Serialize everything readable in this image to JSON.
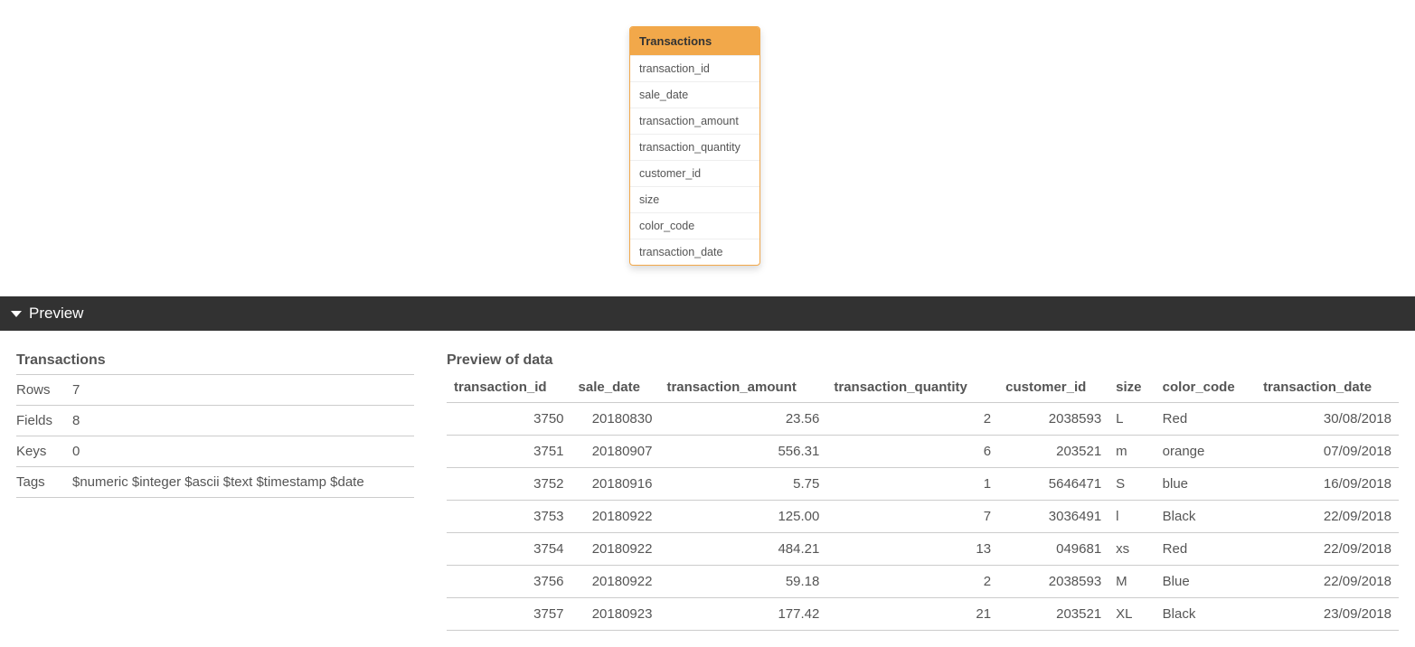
{
  "schema_card": {
    "title": "Transactions",
    "fields": [
      "transaction_id",
      "sale_date",
      "transaction_amount",
      "transaction_quantity",
      "customer_id",
      "size",
      "color_code",
      "transaction_date"
    ]
  },
  "preview_bar": {
    "label": "Preview"
  },
  "meta": {
    "title": "Transactions",
    "rows": {
      "label": "Rows",
      "value": "7"
    },
    "fields": {
      "label": "Fields",
      "value": "8"
    },
    "keys": {
      "label": "Keys",
      "value": "0"
    },
    "tags": {
      "label": "Tags",
      "value": "$numeric $integer $ascii $text $timestamp $date"
    }
  },
  "data_preview": {
    "title": "Preview of data",
    "columns": [
      {
        "name": "transaction_id",
        "align": "num"
      },
      {
        "name": "sale_date",
        "align": "num"
      },
      {
        "name": "transaction_amount",
        "align": "num"
      },
      {
        "name": "transaction_quantity",
        "align": "num"
      },
      {
        "name": "customer_id",
        "align": "num"
      },
      {
        "name": "size",
        "align": "txt"
      },
      {
        "name": "color_code",
        "align": "txt"
      },
      {
        "name": "transaction_date",
        "align": "num"
      }
    ],
    "rows": [
      [
        "3750",
        "20180830",
        "23.56",
        "2",
        "2038593",
        "L",
        "Red",
        "30/08/2018"
      ],
      [
        "3751",
        "20180907",
        "556.31",
        "6",
        "203521",
        "m",
        "orange",
        "07/09/2018"
      ],
      [
        "3752",
        "20180916",
        "5.75",
        "1",
        "5646471",
        "S",
        "blue",
        "16/09/2018"
      ],
      [
        "3753",
        "20180922",
        "125.00",
        "7",
        "3036491",
        "l",
        "Black",
        "22/09/2018"
      ],
      [
        "3754",
        "20180922",
        "484.21",
        "13",
        "049681",
        "xs",
        "Red",
        "22/09/2018"
      ],
      [
        "3756",
        "20180922",
        "59.18",
        "2",
        "2038593",
        "M",
        "Blue",
        "22/09/2018"
      ],
      [
        "3757",
        "20180923",
        "177.42",
        "21",
        "203521",
        "XL",
        "Black",
        "23/09/2018"
      ]
    ]
  }
}
